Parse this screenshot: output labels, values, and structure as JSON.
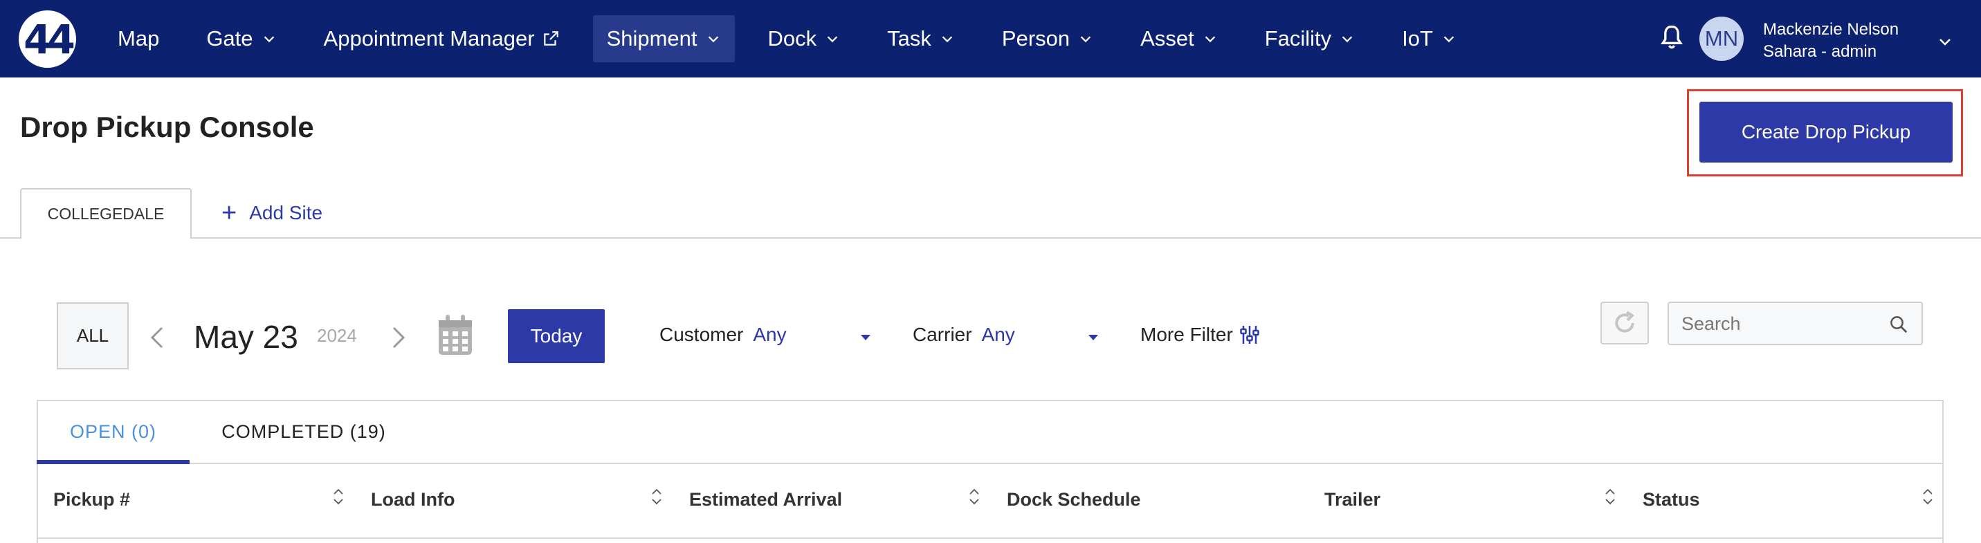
{
  "nav": {
    "logo_text": "44",
    "items": [
      {
        "label": "Map",
        "dropdown": false,
        "external": false,
        "active": false
      },
      {
        "label": "Gate",
        "dropdown": true,
        "external": false,
        "active": false
      },
      {
        "label": "Appointment Manager",
        "dropdown": false,
        "external": true,
        "active": false
      },
      {
        "label": "Shipment",
        "dropdown": true,
        "external": false,
        "active": true
      },
      {
        "label": "Dock",
        "dropdown": true,
        "external": false,
        "active": false
      },
      {
        "label": "Task",
        "dropdown": true,
        "external": false,
        "active": false
      },
      {
        "label": "Person",
        "dropdown": true,
        "external": false,
        "active": false
      },
      {
        "label": "Asset",
        "dropdown": true,
        "external": false,
        "active": false
      },
      {
        "label": "Facility",
        "dropdown": true,
        "external": false,
        "active": false
      },
      {
        "label": "IoT",
        "dropdown": true,
        "external": false,
        "active": false
      }
    ],
    "user": {
      "initials": "MN",
      "name": "Mackenzie Nelson",
      "role": "Sahara - admin"
    },
    "colors": {
      "navbar_bg": "#0c2170",
      "active_item_bg": "#283a8c"
    }
  },
  "page": {
    "title": "Drop Pickup Console",
    "create_button": "Create Drop Pickup",
    "primary_color": "#2e39a8",
    "highlight_color": "#e03c31"
  },
  "site_tabs": {
    "active": "COLLEGEDALE",
    "add_label": "Add Site"
  },
  "filters": {
    "all_label": "ALL",
    "date_main": "May 23",
    "date_year": "2024",
    "today_label": "Today",
    "customer": {
      "label": "Customer",
      "value": "Any"
    },
    "carrier": {
      "label": "Carrier",
      "value": "Any"
    },
    "more_filter_label": "More Filter",
    "search_placeholder": "Search"
  },
  "status_tabs": [
    {
      "label": "OPEN (0)",
      "active": true
    },
    {
      "label": "COMPLETED (19)",
      "active": false
    }
  ],
  "table": {
    "columns": [
      {
        "label": "Pickup #",
        "sortable": true
      },
      {
        "label": "Load Info",
        "sortable": true
      },
      {
        "label": "Estimated Arrival",
        "sortable": true
      },
      {
        "label": "Dock Schedule",
        "sortable": false
      },
      {
        "label": "Trailer",
        "sortable": true
      },
      {
        "label": "Status",
        "sortable": true
      }
    ]
  }
}
